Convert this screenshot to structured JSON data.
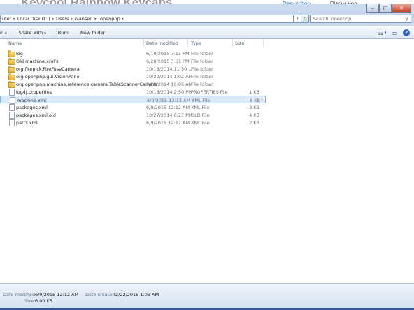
{
  "background_page": {
    "title": "Keycool Rainbow Keycaps",
    "tab_description": "Description",
    "tab_discussion": "Discussion"
  },
  "window": {
    "minimize_label": "–",
    "maximize_label": "□",
    "close_label": "✕"
  },
  "address": {
    "crumbs": [
      "uter",
      "Local Disk (C:)",
      "Users",
      "njansen",
      ".openpnp"
    ],
    "separator": "▸",
    "dropdown": "▾",
    "refresh": "↻"
  },
  "search": {
    "placeholder": "Search .openpnp",
    "icon": "search-icon"
  },
  "toolbar": {
    "organize": "en",
    "share_with": "Share with",
    "burn": "Burn",
    "new_folder": "New folder",
    "dropdown": "▾",
    "views_icon": "☷",
    "preview_icon": "▭",
    "help": "?"
  },
  "columns": {
    "name": "Name",
    "date_modified": "Date modified",
    "type": "Type",
    "size": "Size"
  },
  "files": [
    {
      "name": "log",
      "date": "6/10/2015 7:11 PM",
      "type": "File folder",
      "size": "",
      "kind": "folder"
    },
    {
      "name": "Old machine.xml's",
      "date": "6/20/2015 3:51 PM",
      "type": "File folder",
      "size": "",
      "kind": "folder"
    },
    {
      "name": "org.firepick.FireFuseCamera",
      "date": "10/18/2014 11:50 ...",
      "type": "File folder",
      "size": "",
      "kind": "folder"
    },
    {
      "name": "org.openpnp.gui.VisionPanel",
      "date": "10/22/2014 1:02 AM",
      "type": "File folder",
      "size": "",
      "kind": "folder"
    },
    {
      "name": "org.openpnp.machine.reference.camera.TableScannerCamera",
      "date": "9/28/2014 10:06 AM",
      "type": "File folder",
      "size": "",
      "kind": "folder"
    },
    {
      "name": "log4j.properties",
      "date": "10/18/2014 2:50 PM",
      "type": "PROPERTIES File",
      "size": "1 KB",
      "kind": "file"
    },
    {
      "name": "machine.xml",
      "date": "6/9/2015 12:12 AM",
      "type": "XML File",
      "size": "6 KB",
      "kind": "file",
      "selected": true
    },
    {
      "name": "packages.xml",
      "date": "6/9/2015 12:12 AM",
      "type": "XML File",
      "size": "3 KB",
      "kind": "file"
    },
    {
      "name": "packages.xml.old",
      "date": "10/27/2014 6:27 PM",
      "type": "OLD File",
      "size": "4 KB",
      "kind": "file"
    },
    {
      "name": "parts.xml",
      "date": "6/9/2015 12:12 AM",
      "type": "XML File",
      "size": "2 KB",
      "kind": "file"
    }
  ],
  "details": {
    "date_modified_label": "Date modified:",
    "date_modified_value": "6/9/2015 12:12 AM",
    "date_created_label": "Date created:",
    "date_created_value": "2/22/2015 1:03 AM",
    "size_label": "Size:",
    "size_value": "6.00 KB"
  }
}
